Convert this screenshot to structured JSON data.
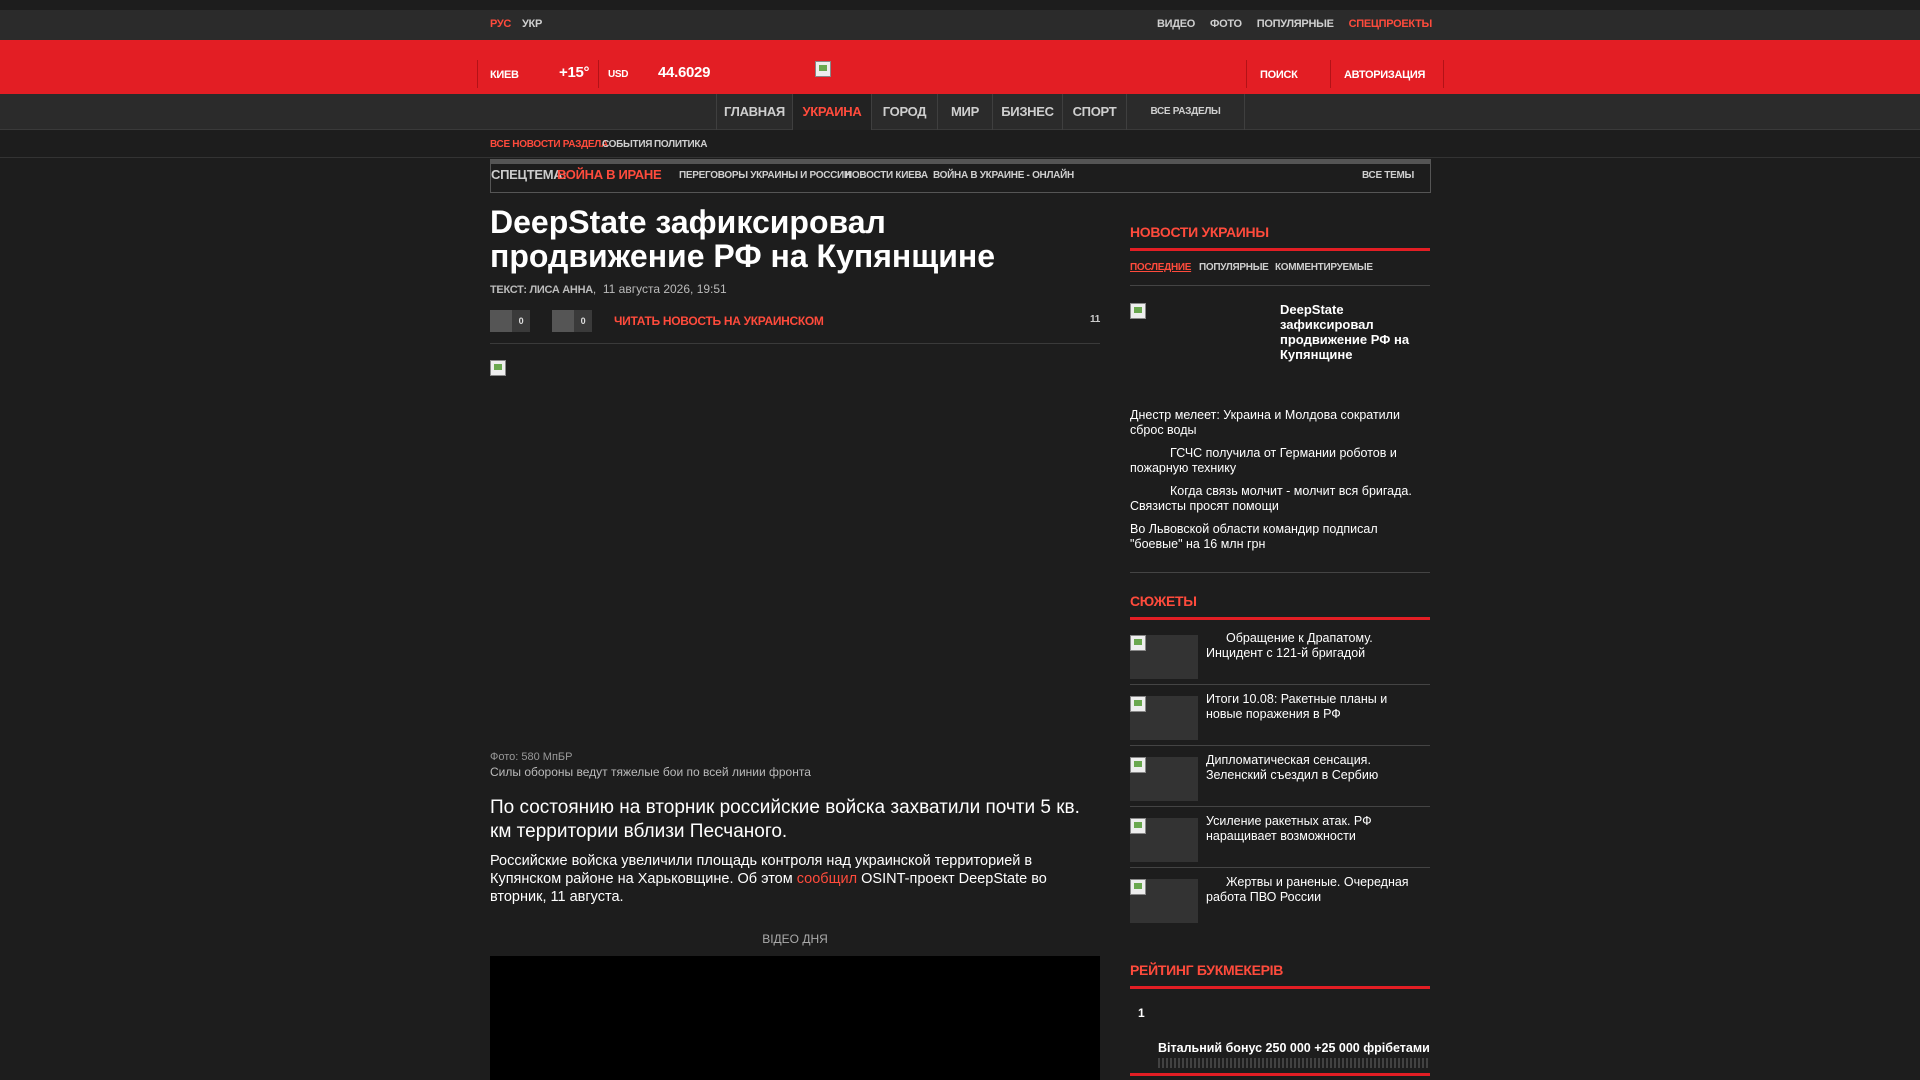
{
  "topbar": {
    "lang_ru": "РУС",
    "lang_uk": "УКР",
    "links": [
      "ВИДЕО",
      "ФОТО",
      "ПОПУЛЯРНЫЕ",
      "СПЕЦПРОЕКТЫ"
    ]
  },
  "header": {
    "city": "КИЕВ",
    "temp": "+15°",
    "currency": "USD",
    "rate": "44.6029",
    "search": "ПОИСК",
    "auth": "АВТОРИЗАЦИЯ"
  },
  "nav": {
    "items": [
      "ГЛАВНАЯ",
      "УКРАИНА",
      "ГОРОД",
      "МИР",
      "БИЗНЕС",
      "СПОРТ"
    ],
    "all": "ВСЕ РАЗДЕЛЫ"
  },
  "subnav": [
    "ВСЕ НОВОСТИ РАЗДЕЛА",
    "СОБЫТИЯ",
    "ПОЛИТИКА"
  ],
  "spec": {
    "label": "СПЕЦТЕМА:",
    "topic": "ВОЙНА В ИРАНЕ",
    "links": [
      "ПЕРЕГОВОРЫ УКРАИНЫ И РОССИИ",
      "НОВОСТИ КИЕВА",
      "ВОЙНА В УКРАИНЕ - ОНЛАЙН"
    ],
    "all": "ВСЕ ТЕМЫ"
  },
  "article": {
    "title": "DeepState зафиксировал продвижение РФ на Купянщине",
    "author_label": "ТЕКСТ: ЛИСА АННА",
    "date": "11 августа 2026, 19:51",
    "likes": "0",
    "dislikes": "0",
    "read_ukr": "ЧИТАТЬ НОВОСТЬ НА УКРАИНСКОМ",
    "comments": "11",
    "photo_credit": "Фото: 580 МпБР",
    "caption": "Силы обороны ведут тяжелые бои по всей линии фронта",
    "lead": "По состоянию на вторник российские войска захватили почти 5 кв. км территории вблизи Песчаного.",
    "body_a": "Российские войска увеличили площадь контроля над украинской территорией в Купянском районе на Харьковщине. Об этом",
    "body_link": "сообщил",
    "body_b": "OSINT-проект DeepState во вторник, 11 августа.",
    "video_day": "ВІДЕО ДНЯ"
  },
  "sidebar": {
    "news_heading": "НОВОСТИ УКРАИНЫ",
    "tabs": [
      "ПОСЛЕДНИЕ",
      "ПОПУЛЯРНЫЕ",
      "КОММЕНТИРУЕМЫЕ"
    ],
    "featured": "DeepState зафиксировал продвижение РФ на Купянщине",
    "news": [
      "Днестр мелеет: Украина и Молдова сократили сброс воды",
      "ГСЧС получила от Германии роботов и пожарную технику",
      "Когда связь молчит - молчит вся бригада. Связисты просят помощи",
      "Во Львовской области командир подписал \"боевые\" на 16 млн грн"
    ],
    "plots_heading": "СЮЖЕТЫ",
    "plots": [
      "Обращение к Драпатому. Инцидент с 121-й бригадой",
      "Итоги 10.08: Ракетные планы и новые поражения в РФ",
      "Дипломатическая сенсация. Зеленский съездил в Сербию",
      "Усиление ракетных атак. РФ наращивает возможности",
      "Жертвы и раненые. Очередная работа ПВО России"
    ],
    "rating_heading": "РЕЙТИНГ БУКМЕКЕРІВ",
    "rating_rank": "1",
    "rating_bonus": "Вітальний бонус 250 000 +25 000 фрібетами"
  },
  "colors": {
    "accent": "#e31e24",
    "link": "#ff4b3c"
  }
}
